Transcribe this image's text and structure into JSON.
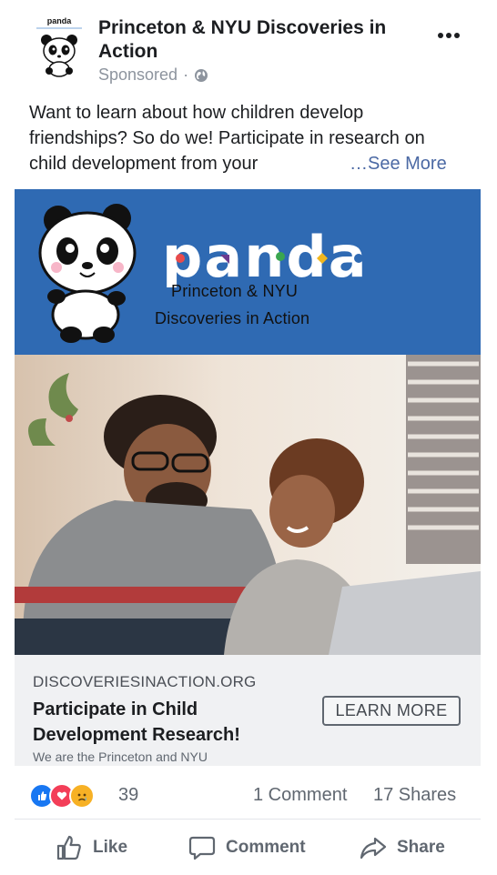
{
  "post": {
    "page_name": "Princeton & NYU Discoveries in Action",
    "sponsored_label": "Sponsored",
    "separator": "·",
    "avatar_wordmark": "panda",
    "more_icon": "more-dots-icon",
    "body_text": "Want to learn about how children develop friendships? So do we! Participate in research on child development from your",
    "see_more": "…See More"
  },
  "banner": {
    "wordmark": "panda",
    "line1": "Princeton & NYU",
    "line2": "Discoveries in Action",
    "background": "#2f6ab3"
  },
  "cta": {
    "domain": "DISCOVERIESINACTION.ORG",
    "title": "Participate in Child Development Research!",
    "description": "We are the Princeton and NYU",
    "button": "LEARN MORE"
  },
  "engagement": {
    "reaction_icons": [
      "like-reaction-icon",
      "love-reaction-icon",
      "sad-reaction-icon"
    ],
    "reaction_count": "39",
    "comments": "1 Comment",
    "shares": "17 Shares"
  },
  "actions": {
    "like": "Like",
    "comment": "Comment",
    "share": "Share"
  },
  "colors": {
    "accent": "#4b69a4",
    "like_blue": "#1877f2",
    "love_red": "#f33e58",
    "sad_yellow": "#f7b125"
  }
}
